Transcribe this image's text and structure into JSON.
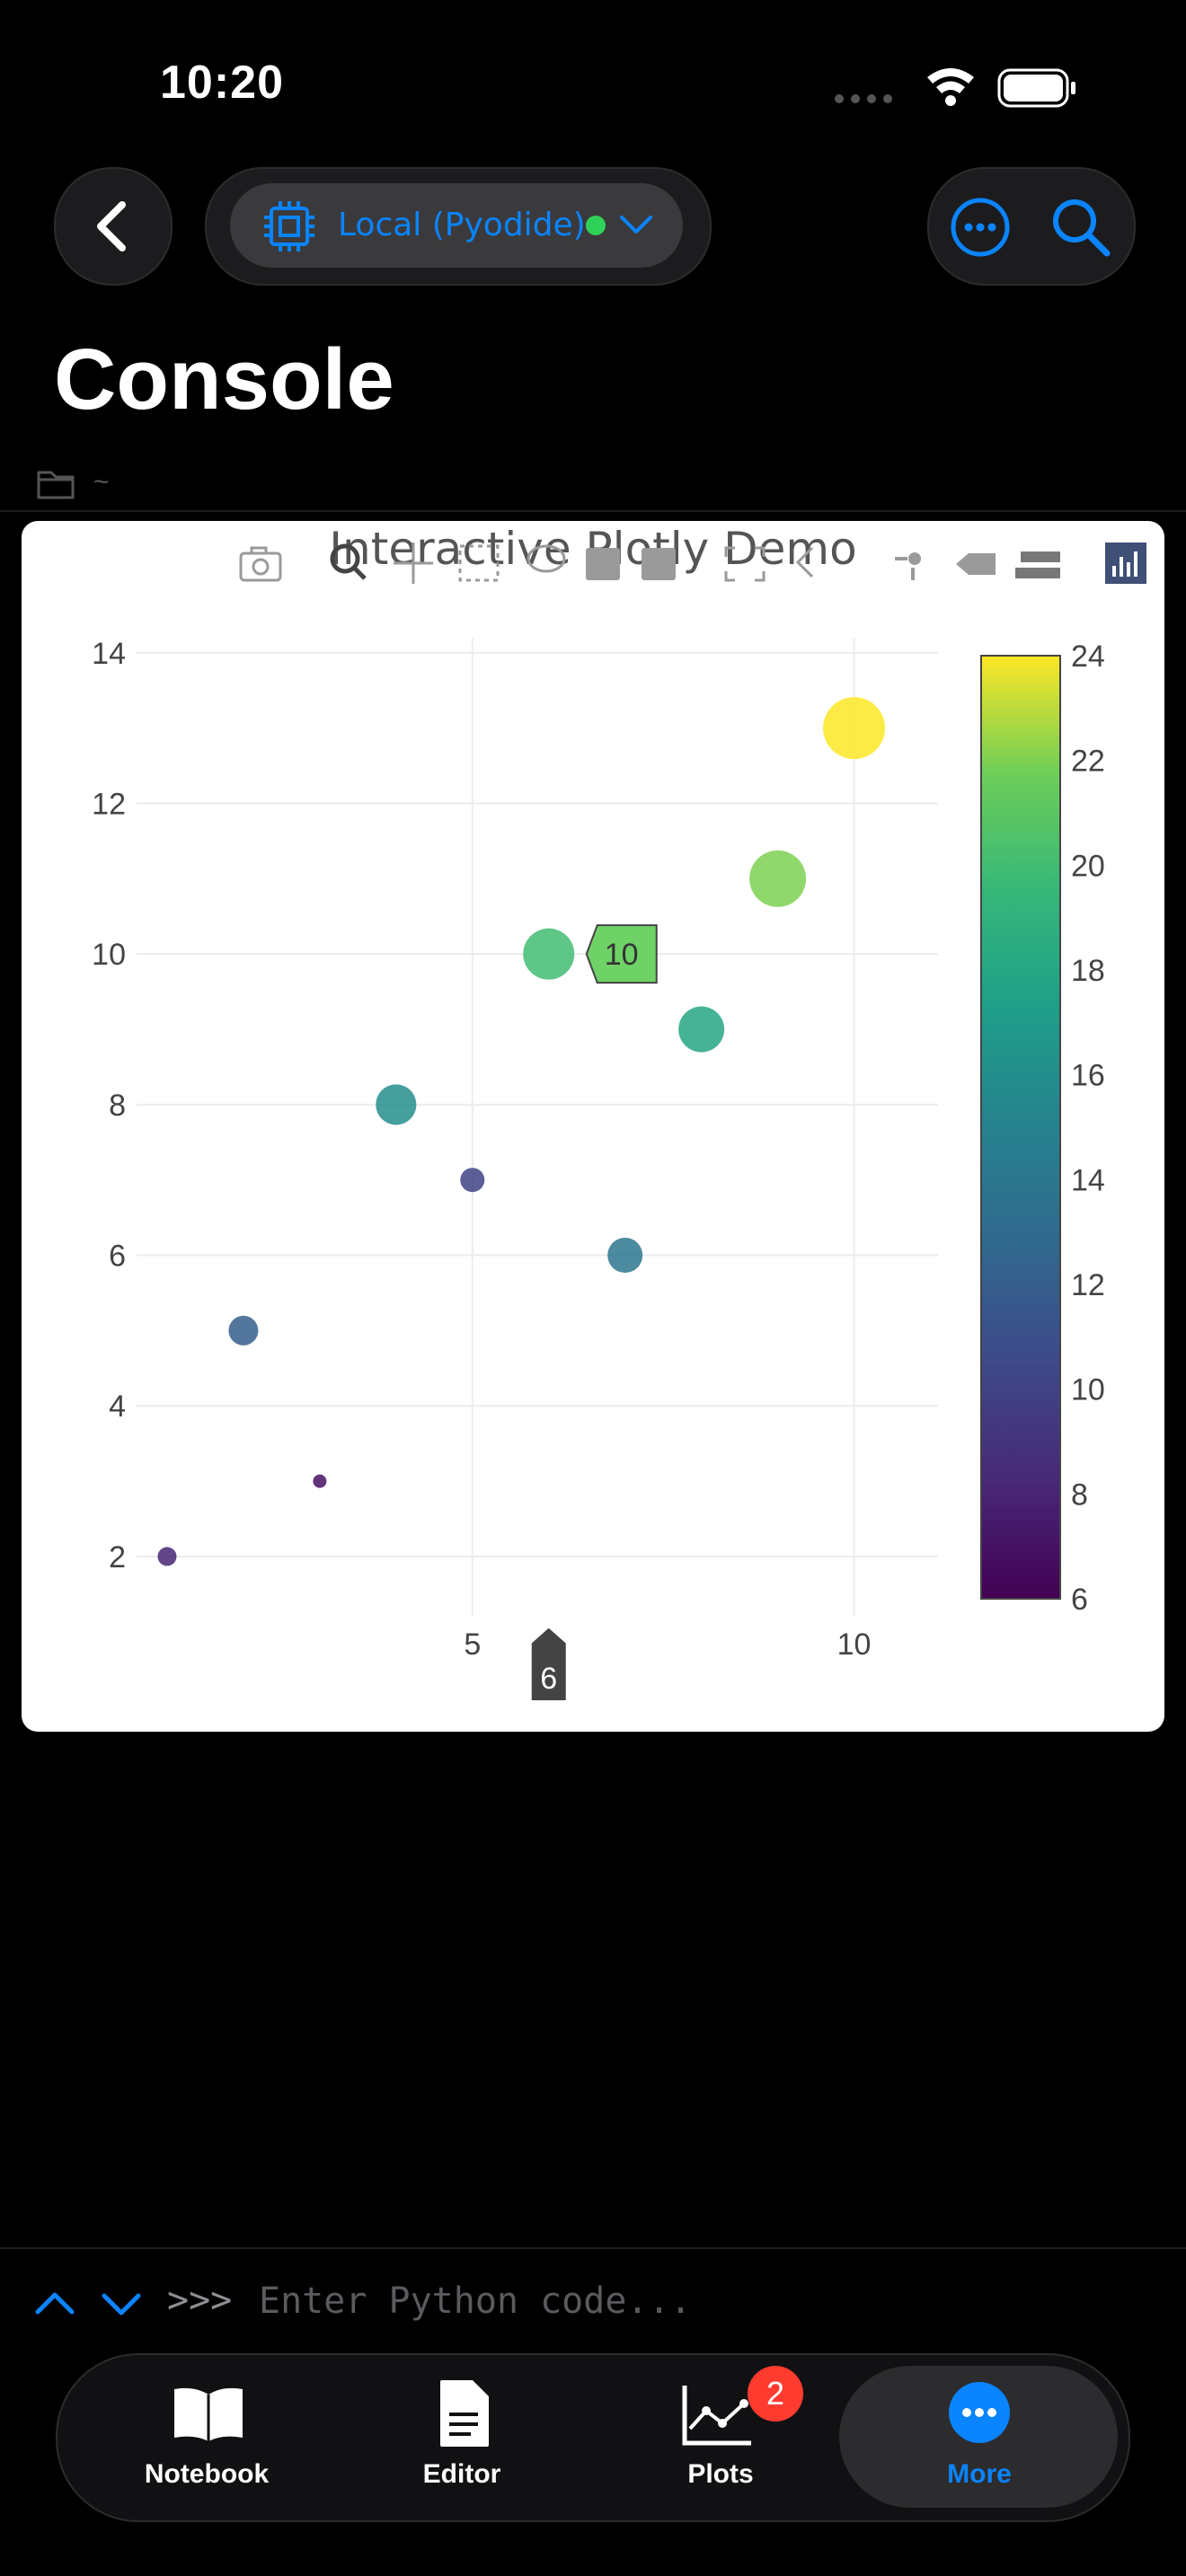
{
  "status": {
    "time": "10:20"
  },
  "header": {
    "environment": "Local (Pyodide)",
    "title": "Console",
    "path": "~"
  },
  "plot": {
    "title": "Interactive Plotly Demo",
    "hover_y_label": "10",
    "hover_x_label": "6"
  },
  "chart_data": {
    "type": "scatter",
    "title": "Interactive Plotly Demo",
    "xlabel": "",
    "ylabel": "",
    "xlim": [
      0.6,
      11.1
    ],
    "ylim": [
      1.2,
      14.2
    ],
    "x_ticks": [
      5,
      10
    ],
    "y_ticks": [
      2,
      4,
      6,
      8,
      10,
      12,
      14
    ],
    "grid": true,
    "colorscale": "Viridis",
    "colorbar": {
      "min": 6,
      "max": 24,
      "ticks": [
        6,
        8,
        10,
        12,
        14,
        16,
        18,
        20,
        22,
        24
      ]
    },
    "points": [
      {
        "x": 1,
        "y": 2,
        "size": 7,
        "color": 8
      },
      {
        "x": 2,
        "y": 5,
        "size": 11,
        "color": 12
      },
      {
        "x": 3,
        "y": 3,
        "size": 5,
        "color": 7
      },
      {
        "x": 4,
        "y": 8,
        "size": 15,
        "color": 16
      },
      {
        "x": 5,
        "y": 7,
        "size": 9,
        "color": 10
      },
      {
        "x": 6,
        "y": 10,
        "size": 19,
        "color": 20
      },
      {
        "x": 7,
        "y": 6,
        "size": 13,
        "color": 14
      },
      {
        "x": 8,
        "y": 9,
        "size": 17,
        "color": 18
      },
      {
        "x": 9,
        "y": 11,
        "size": 21,
        "color": 22
      },
      {
        "x": 10,
        "y": 13,
        "size": 23,
        "color": 24
      }
    ]
  },
  "input": {
    "prompt": ">>>",
    "placeholder": "Enter Python code..."
  },
  "tabs": [
    {
      "label": "Notebook",
      "active": false
    },
    {
      "label": "Editor",
      "active": false
    },
    {
      "label": "Plots",
      "active": false,
      "badge": "2"
    },
    {
      "label": "More",
      "active": true
    }
  ],
  "colors": {
    "accent": "#0a84ff",
    "status_dot": "#30d158",
    "badge": "#ff3b30"
  }
}
